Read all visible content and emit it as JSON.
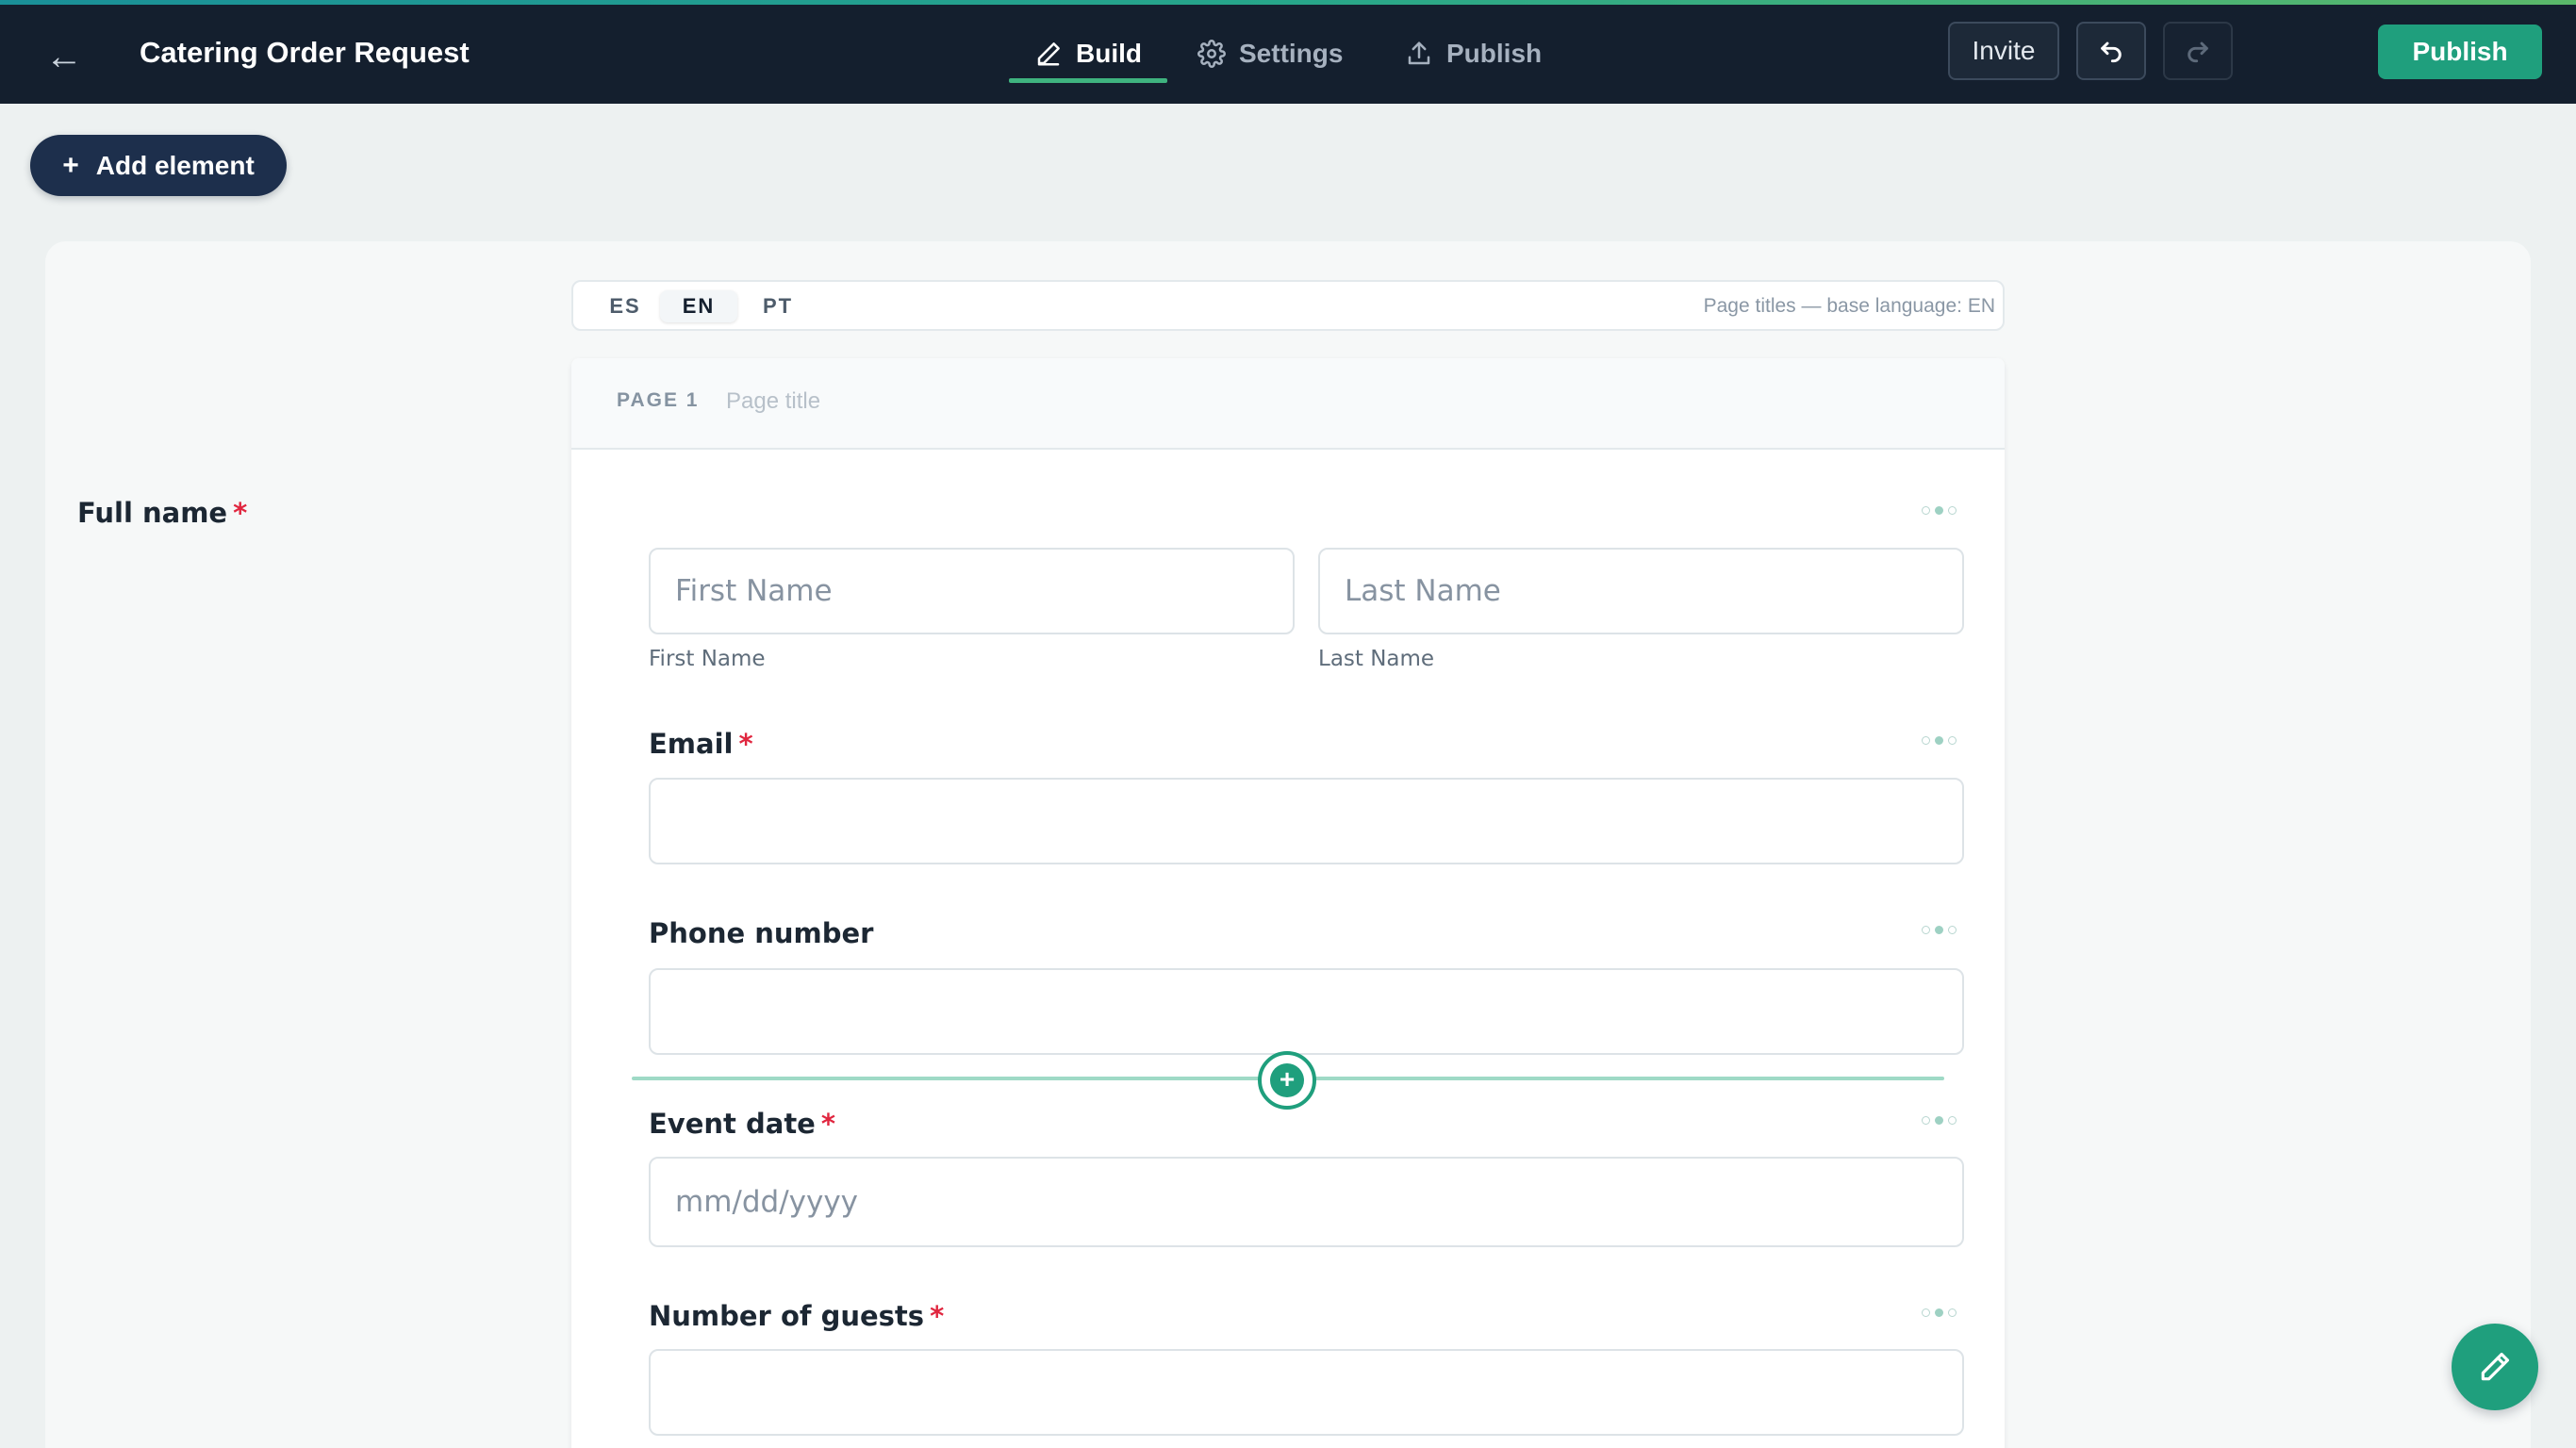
{
  "header": {
    "back_icon": "arrow-left-icon",
    "title": "Catering Order Request",
    "tabs": [
      {
        "label": "Build",
        "icon": "pencil-icon",
        "active": true
      },
      {
        "label": "Settings",
        "icon": "gear-icon",
        "active": false
      },
      {
        "label": "Publish",
        "icon": "upload-icon",
        "active": false
      }
    ],
    "invite_label": "Invite",
    "undo_icon": "undo-icon",
    "redo_icon": "redo-icon",
    "publish_label": "Publish",
    "accent_color": "#1f9f7d"
  },
  "toolbar": {
    "add_element_label": "Add element"
  },
  "languages": {
    "items": [
      "ES",
      "EN",
      "PT"
    ],
    "selected": "EN",
    "note": "Page titles — base language: EN"
  },
  "page": {
    "number_label": "PAGE 1",
    "title_placeholder": "Page title"
  },
  "fields": {
    "full_name": {
      "label": "Full name",
      "required": "*",
      "first_placeholder": "First Name",
      "last_placeholder": "Last Name",
      "first_sublabel": "First Name",
      "last_sublabel": "Last Name"
    },
    "email": {
      "label": "Email",
      "required": "*"
    },
    "phone": {
      "label": "Phone number"
    },
    "event_date": {
      "label": "Event date",
      "required": "*",
      "placeholder": "mm/dd/yyyy"
    },
    "guests": {
      "label": "Number of guests",
      "required": "*"
    }
  },
  "insert_icon": "plus-icon",
  "fab_icon": "pencil-icon"
}
